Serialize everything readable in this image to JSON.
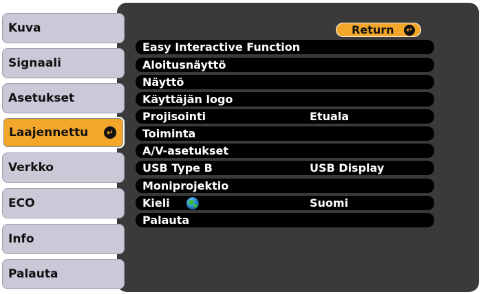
{
  "tabs": [
    {
      "label": "Kuva",
      "active": false
    },
    {
      "label": "Signaali",
      "active": false
    },
    {
      "label": "Asetukset",
      "active": false
    },
    {
      "label": "Laajennettu",
      "active": true
    },
    {
      "label": "Verkko",
      "active": false
    },
    {
      "label": "ECO",
      "active": false
    },
    {
      "label": "Info",
      "active": false
    },
    {
      "label": "Palauta",
      "active": false
    }
  ],
  "return_button": {
    "label": "Return",
    "icon": "enter-icon"
  },
  "menu": [
    {
      "label": "Easy Interactive Function",
      "value": ""
    },
    {
      "label": "Aloitusnäyttö",
      "value": ""
    },
    {
      "label": "Näyttö",
      "value": ""
    },
    {
      "label": "Käyttäjän logo",
      "value": ""
    },
    {
      "label": "Projisointi",
      "value": "Etuala"
    },
    {
      "label": "Toiminta",
      "value": ""
    },
    {
      "label": "A/V-asetukset",
      "value": ""
    },
    {
      "label": "USB Type B",
      "value": "USB Display"
    },
    {
      "label": "Moniprojektio",
      "value": ""
    },
    {
      "label": "Kieli",
      "value": "Suomi",
      "icon": "globe-icon"
    },
    {
      "label": "Palauta",
      "value": ""
    }
  ],
  "colors": {
    "accent": "#f3a72a",
    "panel": "#3a3a3a",
    "tab": "#c9c9d8",
    "row": "#000000"
  }
}
